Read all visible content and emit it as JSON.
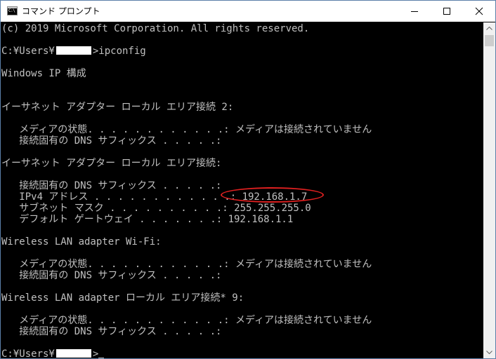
{
  "window": {
    "title": "コマンド プロンプト",
    "icon": "cmd-icon",
    "icon_text": "C:\\",
    "controls": {
      "minimize_icon": "minimize-icon",
      "maximize_icon": "maximize-icon",
      "close_icon": "close-icon"
    }
  },
  "console": {
    "copyright": "(c) 2019 Microsoft Corporation. All rights reserved.",
    "prompt1_prefix": "C:¥Users¥",
    "prompt1_suffix": ">ipconfig",
    "ip_config_title": "Windows IP 構成",
    "adapter1_header": "イーサネット アダプター ローカル エリア接続 2:",
    "adapter1_media_state": "   メディアの状態. . . . . . . . . . . .: メディアは接続されていません",
    "adapter1_dns_suffix": "   接続固有の DNS サフィックス . . . . .:",
    "adapter2_header": "イーサネット アダプター ローカル エリア接続:",
    "adapter2_dns_suffix": "   接続固有の DNS サフィックス . . . . .:",
    "adapter2_ipv4": "   IPv4 アドレス . . . . . . . . . . . .: 192.168.1.7",
    "adapter2_subnet": "   サブネット マスク . . . . . . . . . .: 255.255.255.0",
    "adapter2_gateway": "   デフォルト ゲートウェイ . . . . . . .: 192.168.1.1",
    "adapter3_header": "Wireless LAN adapter Wi-Fi:",
    "adapter3_media_state": "   メディアの状態. . . . . . . . . . . .: メディアは接続されていません",
    "adapter3_dns_suffix": "   接続固有の DNS サフィックス . . . . .:",
    "adapter4_header": "Wireless LAN adapter ローカル エリア接続* 9:",
    "adapter4_media_state": "   メディアの状態. . . . . . . . . . . .: メディアは接続されていません",
    "adapter4_dns_suffix": "   接続固有の DNS サフィックス . . . . .:",
    "prompt2_prefix": "C:¥Users¥",
    "prompt2_suffix": ">"
  },
  "annotation": {
    "highlight_color": "#e02020"
  },
  "colors": {
    "console_background": "#000000",
    "console_text": "#c0c0c0",
    "redaction": "#ffffff"
  }
}
